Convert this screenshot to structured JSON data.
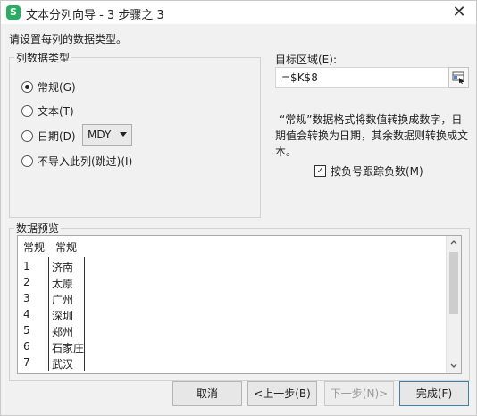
{
  "window": {
    "title": "文本分列向导 - 3 步骤之 3",
    "close_label": "✕",
    "logo_letter": "S"
  },
  "instructions": "请设置每列的数据类型。",
  "column_type_group": {
    "legend": "列数据类型",
    "options": [
      {
        "label": "常规(G)",
        "selected": true
      },
      {
        "label": "文本(T)",
        "selected": false
      },
      {
        "label": "日期(D)",
        "selected": false
      },
      {
        "label": "不导入此列(跳过)(I)",
        "selected": false
      }
    ],
    "date_format": "MDY"
  },
  "target": {
    "label": "目标区域(E):",
    "value": "=$K$8"
  },
  "description": {
    "line1": "“常规”数据格式将数值转换成数字，日",
    "line2": "期值会转换为日期，其余数据则转换成文",
    "line3": "本。"
  },
  "negative_checkbox": {
    "label": "按负号跟踪负数(M)",
    "checked": true
  },
  "preview": {
    "legend": "数据预览",
    "headers": [
      "常规",
      "常规"
    ],
    "rows": [
      {
        "num": "1",
        "city": "济南"
      },
      {
        "num": "2",
        "city": "太原"
      },
      {
        "num": "3",
        "city": "广州"
      },
      {
        "num": "4",
        "city": "深圳"
      },
      {
        "num": "5",
        "city": "郑州"
      },
      {
        "num": "6",
        "city": "石家庄"
      },
      {
        "num": "7",
        "city": "武汉"
      }
    ]
  },
  "buttons": {
    "cancel": "取消",
    "back": "<上一步(B)",
    "next": "下一步(N)>",
    "finish": "完成(F)"
  },
  "colors": {
    "logo": "#27ae60",
    "dialog_bg": "#f1f1f1",
    "finish_border": "#3c7fb1"
  },
  "icons": {
    "range_selector": "range-select-icon",
    "dropdown": "chevron-down-icon"
  }
}
